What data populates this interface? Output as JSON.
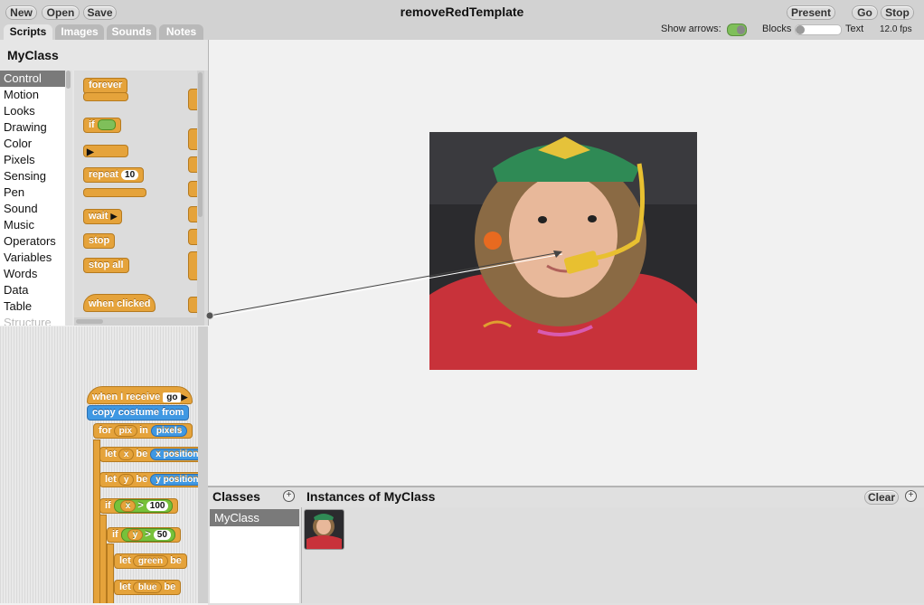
{
  "toolbar": {
    "new": "New",
    "open": "Open",
    "save": "Save",
    "present": "Present",
    "go": "Go",
    "stop": "Stop"
  },
  "title": "removeRedTemplate",
  "tabs": [
    "Scripts",
    "Images",
    "Sounds",
    "Notes"
  ],
  "options": {
    "show_arrows": "Show arrows:",
    "blocks": "Blocks",
    "text": "Text",
    "fps": "12.0 fps"
  },
  "class_name": "MyClass",
  "categories": [
    "Control",
    "Motion",
    "Looks",
    "Drawing",
    "Color",
    "Pixels",
    "Sensing",
    "Pen",
    "Sound",
    "Music",
    "Operators",
    "Variables",
    "Words",
    "Data",
    "Table",
    "Structure"
  ],
  "palette": {
    "forever": "forever",
    "if": "if",
    "repeat": "repeat",
    "repeat_arg": "10",
    "wait": "wait",
    "stop": "stop",
    "stop_all": "stop all",
    "when_clicked": "when clicked"
  },
  "script": {
    "hat": "when I receive",
    "hat_arg": "go",
    "copy": "copy costume from",
    "for": "for",
    "pix": "pix",
    "in": "in",
    "pixels": "pixels",
    "let": "let",
    "be": "be",
    "x": "x",
    "y": "y",
    "xpos": "x position",
    "ypos": "y position",
    "if": "if",
    "gt": ">",
    "v100": "100",
    "v50": "50",
    "green": "green",
    "blue": "blue"
  },
  "bottom": {
    "classes": "Classes",
    "instances": "Instances of MyClass",
    "clear": "Clear",
    "class_item": "MyClass"
  }
}
